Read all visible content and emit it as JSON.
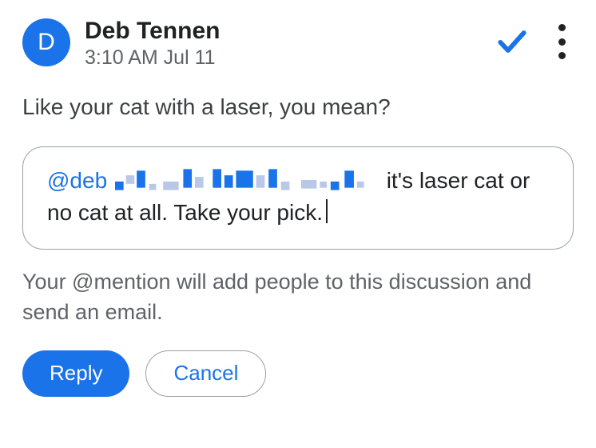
{
  "header": {
    "avatar_initial": "D",
    "name": "Deb Tennen",
    "timestamp": "3:10 AM Jul 11"
  },
  "comment": {
    "text": "Like your cat with a laser, you mean?"
  },
  "reply": {
    "mention": "@deb",
    "text_after": " it's laser cat or no cat at all. Take your pick."
  },
  "mention_note": "Your @mention will add people to this discussion and send an email.",
  "buttons": {
    "reply_label": "Reply",
    "cancel_label": "Cancel"
  }
}
